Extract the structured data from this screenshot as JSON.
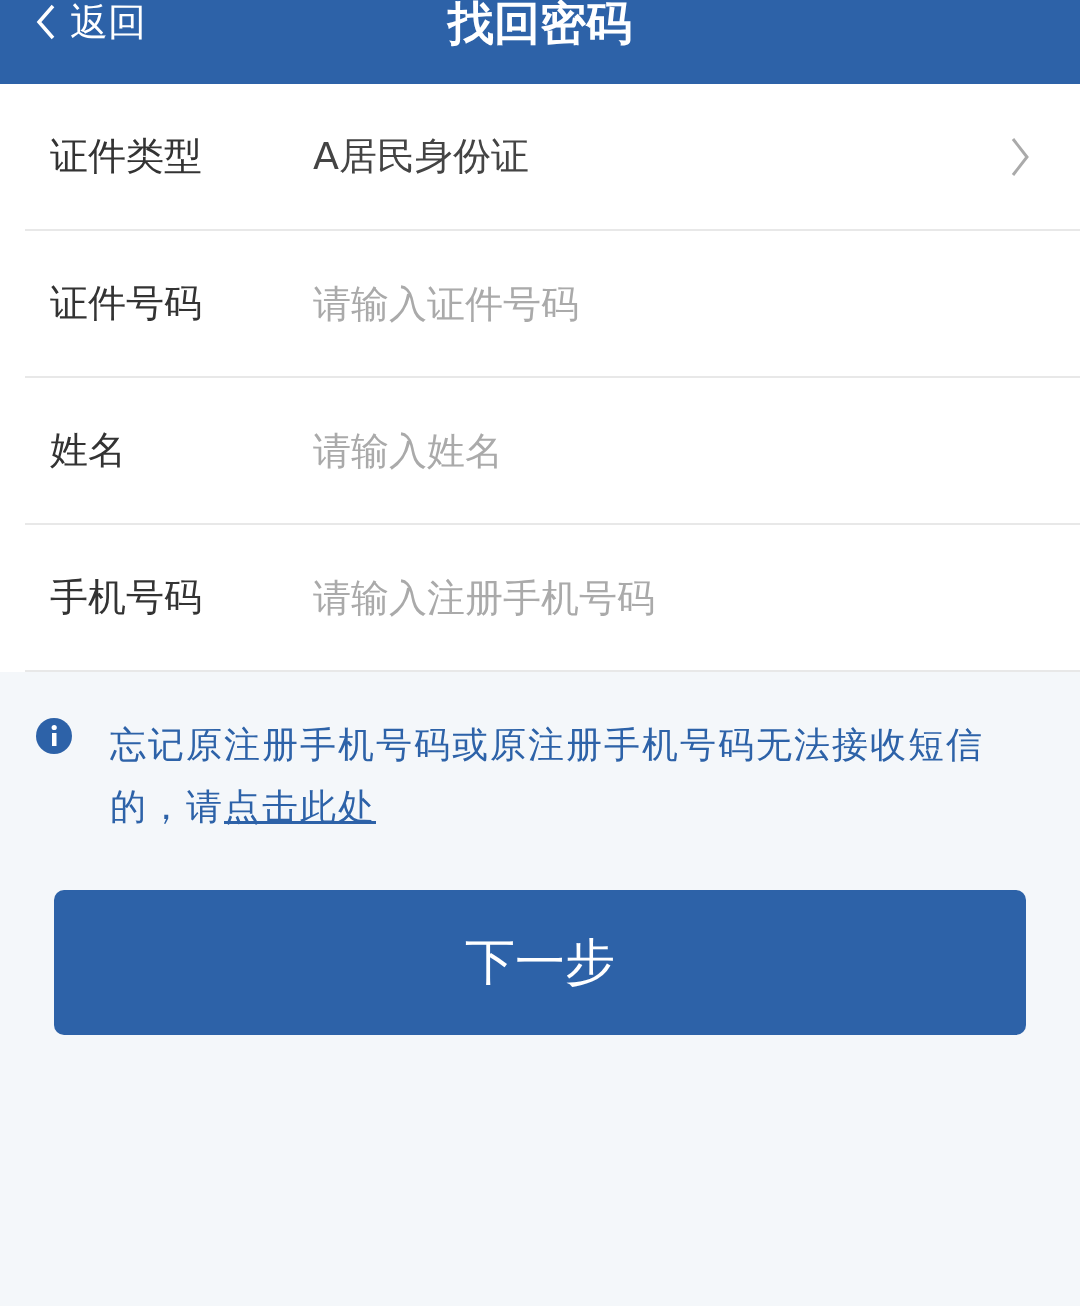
{
  "header": {
    "back_label": "返回",
    "title": "找回密码"
  },
  "form": {
    "rows": [
      {
        "kind": "select",
        "label": "证件类型",
        "value": "A居民身份证"
      },
      {
        "kind": "input",
        "label": "证件号码",
        "placeholder": "请输入证件号码"
      },
      {
        "kind": "input",
        "label": "姓名",
        "placeholder": "请输入姓名"
      },
      {
        "kind": "input",
        "label": "手机号码",
        "placeholder": "请输入注册手机号码"
      }
    ]
  },
  "notice": {
    "text": "忘记原注册手机号码或原注册手机号码无法接收短信的，请",
    "link": "点击此处"
  },
  "next_button": "下一步"
}
